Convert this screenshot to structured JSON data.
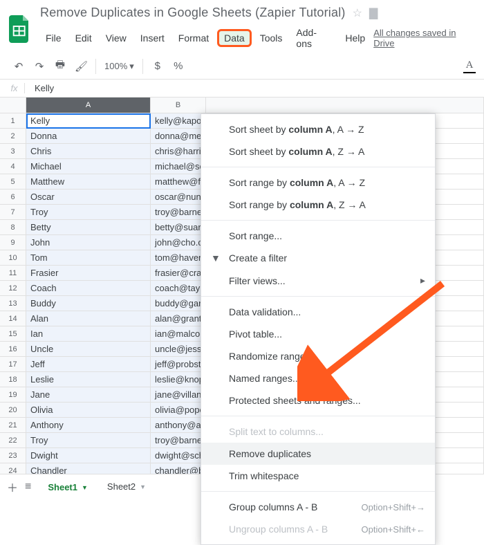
{
  "doc": {
    "title": "Remove Duplicates in Google Sheets (Zapier Tutorial)",
    "saved_text": "All changes saved in Drive"
  },
  "menubar": [
    "File",
    "Edit",
    "View",
    "Insert",
    "Format",
    "Data",
    "Tools",
    "Add-ons",
    "Help"
  ],
  "menubar_active_index": 5,
  "toolbar": {
    "zoom": "100%",
    "currency": "$",
    "percent": "%"
  },
  "formula_bar": {
    "label": "fx",
    "value": "Kelly"
  },
  "columns": [
    "A",
    "B"
  ],
  "selected_column": "A",
  "active_cell": {
    "row": 1,
    "col": 0
  },
  "rows": [
    {
      "n": 1,
      "a": "Kelly",
      "b": "kelly@kapov"
    },
    {
      "n": 2,
      "a": "Donna",
      "b": "donna@mea"
    },
    {
      "n": 3,
      "a": "Chris",
      "b": "chris@harris"
    },
    {
      "n": 4,
      "a": "Michael",
      "b": "michael@sc"
    },
    {
      "n": 5,
      "a": "Matthew",
      "b": "matthew@fc"
    },
    {
      "n": 6,
      "a": "Oscar",
      "b": "oscar@nune"
    },
    {
      "n": 7,
      "a": "Troy",
      "b": "troy@barnes"
    },
    {
      "n": 8,
      "a": "Betty",
      "b": "betty@suare"
    },
    {
      "n": 9,
      "a": "John",
      "b": "john@cho.c"
    },
    {
      "n": 10,
      "a": "Tom",
      "b": "tom@haverf"
    },
    {
      "n": 11,
      "a": "Frasier",
      "b": "frasier@cran"
    },
    {
      "n": 12,
      "a": "Coach",
      "b": "coach@tayl"
    },
    {
      "n": 13,
      "a": "Buddy",
      "b": "buddy@garr"
    },
    {
      "n": 14,
      "a": "Alan",
      "b": "alan@grant."
    },
    {
      "n": 15,
      "a": "Ian",
      "b": "ian@malcoln"
    },
    {
      "n": 16,
      "a": "Uncle",
      "b": "uncle@jesse"
    },
    {
      "n": 17,
      "a": "Jeff",
      "b": "jeff@probst."
    },
    {
      "n": 18,
      "a": "Leslie",
      "b": "leslie@knop"
    },
    {
      "n": 19,
      "a": "Jane",
      "b": "jane@villanu"
    },
    {
      "n": 20,
      "a": "Olivia",
      "b": "olivia@pope"
    },
    {
      "n": 21,
      "a": "Anthony",
      "b": "anthony@an"
    },
    {
      "n": 22,
      "a": "Troy",
      "b": "troy@barnes"
    },
    {
      "n": 23,
      "a": "Dwight",
      "b": "dwight@sch"
    },
    {
      "n": 24,
      "a": "Chandler",
      "b": "chandler@b"
    }
  ],
  "data_menu": [
    {
      "type": "item",
      "html": "Sort sheet by <b>column A</b>, A → Z"
    },
    {
      "type": "item",
      "html": "Sort sheet by <b>column A</b>, Z → A"
    },
    {
      "type": "sep"
    },
    {
      "type": "item",
      "html": "Sort range by <b>column A</b>, A → Z"
    },
    {
      "type": "item",
      "html": "Sort range by <b>column A</b>, Z → A"
    },
    {
      "type": "sep"
    },
    {
      "type": "item",
      "html": "Sort range..."
    },
    {
      "type": "item",
      "html": "Create a filter",
      "icon": "▼"
    },
    {
      "type": "item",
      "html": "Filter views...",
      "submenu": true
    },
    {
      "type": "sep"
    },
    {
      "type": "item",
      "html": "Data validation..."
    },
    {
      "type": "item",
      "html": "Pivot table..."
    },
    {
      "type": "item",
      "html": "Randomize range"
    },
    {
      "type": "item",
      "html": "Named ranges..."
    },
    {
      "type": "item",
      "html": "Protected sheets and ranges..."
    },
    {
      "type": "sep"
    },
    {
      "type": "item",
      "html": "Split text to columns...",
      "disabled": true
    },
    {
      "type": "item",
      "html": "Remove duplicates",
      "hover": true
    },
    {
      "type": "item",
      "html": "Trim whitespace"
    },
    {
      "type": "sep"
    },
    {
      "type": "item",
      "html": "Group columns A - B",
      "shortcut": "Option+Shift+→"
    },
    {
      "type": "item",
      "html": "Ungroup columns A - B",
      "shortcut": "Option+Shift+←",
      "disabled": true
    }
  ],
  "tabs": {
    "items": [
      {
        "name": "Sheet1",
        "active": true
      },
      {
        "name": "Sheet2",
        "active": false
      }
    ]
  },
  "annotation": {
    "highlight_menu": "Data",
    "arrow_target": "Remove duplicates"
  }
}
